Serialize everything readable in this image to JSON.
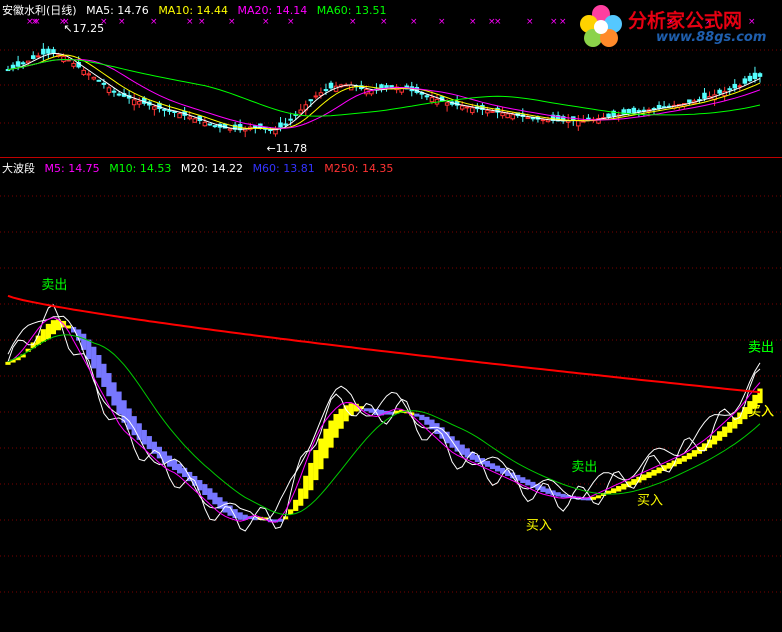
{
  "top_panel": {
    "title": "安徽水利(日线)",
    "ma": [
      {
        "label": "MA5: 14.76",
        "color": "#ffffff"
      },
      {
        "label": "MA10: 14.44",
        "color": "#ffff00"
      },
      {
        "label": "MA20: 14.14",
        "color": "#ff00ff"
      },
      {
        "label": "MA60: 13.51",
        "color": "#00ff00"
      }
    ],
    "high_label": "17.25",
    "low_label": "11.78"
  },
  "bottom_panel": {
    "title": "大波段",
    "ma": [
      {
        "label": "M5: 14.75",
        "color": "#ff00ff"
      },
      {
        "label": "M10: 14.53",
        "color": "#00ff00"
      },
      {
        "label": "M20: 14.22",
        "color": "#ffffff"
      },
      {
        "label": "M60: 13.81",
        "color": "#3333ff"
      },
      {
        "label": "M250: 14.35",
        "color": "#ff3333"
      }
    ]
  },
  "logo": {
    "text": "分析家公式网",
    "url": "www.88gs.com"
  },
  "colors": {
    "background": "#000000",
    "divider": "#c00000",
    "grid": "#7a0000",
    "up_candle": "#ff3333",
    "down_candle": "#54ffff",
    "band_up": "#ffff00",
    "band_down": "#7777ff",
    "m250": "#ff0000"
  },
  "chart_data": {
    "type": "line",
    "title": "大波段",
    "x_count": 150,
    "y_range_price": [
      11.2,
      17.6
    ],
    "series": [
      {
        "name": "M5",
        "values": [
          15.1,
          15.3,
          15.6,
          15.9,
          16.0,
          15.8,
          15.4,
          15.0,
          14.6,
          14.2,
          13.8,
          13.6,
          13.4,
          13.2,
          13.0,
          12.9,
          12.7,
          12.5,
          12.3,
          12.1,
          12.0,
          11.95,
          12.1,
          12.0,
          11.9,
          12.2,
          12.7,
          13.3,
          13.8,
          14.1,
          14.3,
          14.3,
          14.1,
          14.0,
          14.1,
          14.2,
          14.1,
          13.9,
          13.7,
          13.5,
          13.3,
          13.2,
          13.1,
          13.0,
          12.9,
          12.8,
          12.7,
          12.6,
          12.5,
          12.45,
          12.4,
          12.45,
          12.4,
          12.5,
          12.6,
          12.7,
          12.8,
          12.9,
          13.0,
          13.1,
          13.2,
          13.3,
          13.45,
          13.6,
          13.8,
          14.0,
          14.2,
          14.5,
          14.75
        ]
      },
      {
        "name": "M10"
      },
      {
        "name": "M20"
      },
      {
        "name": "M60"
      },
      {
        "name": "M250"
      }
    ],
    "annotations": [
      {
        "text": "卖出",
        "x_index": 4
      },
      {
        "text": "买入",
        "x_index": 48
      },
      {
        "text": "卖出",
        "x_index": 52
      },
      {
        "text": "买入",
        "x_index": 58
      },
      {
        "text": "卖出",
        "x_index": 74
      },
      {
        "text": "买入",
        "x_index": 82
      },
      {
        "text": "卖出",
        "x_index": 87
      },
      {
        "text": "买入",
        "x_index": 115
      },
      {
        "text": "卖出",
        "x_index": 118
      },
      {
        "text": "买入",
        "x_index": 124
      }
    ]
  }
}
